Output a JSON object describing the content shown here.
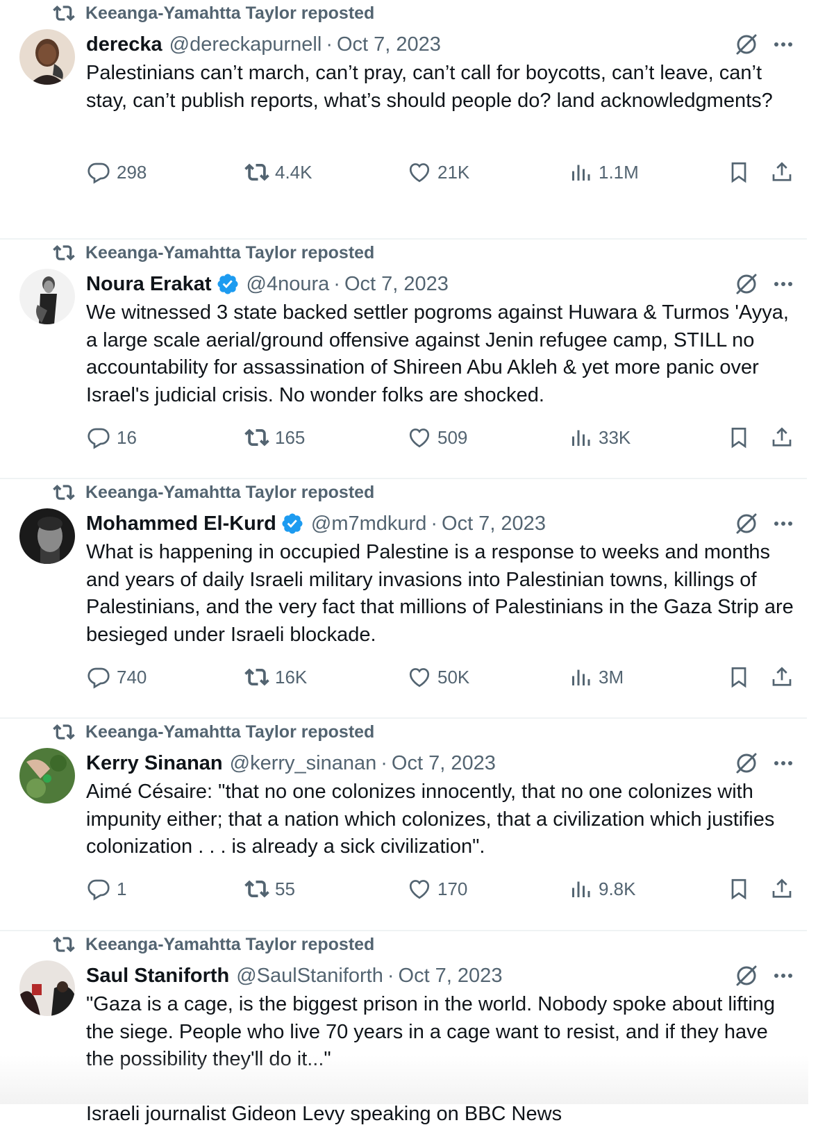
{
  "reposter_label": "Keeanga-Yamahtta Taylor reposted",
  "colors": {
    "text_primary": "#0f1419",
    "text_secondary": "#536471",
    "verified_badge": "#1d9bf0",
    "divider": "#eff3f4"
  },
  "icons": {
    "repost": "repost-icon",
    "reply": "reply-icon",
    "like": "heart-icon",
    "views": "views-icon",
    "bookmark": "bookmark-icon",
    "share": "share-icon",
    "grok": "grok-icon",
    "more": "more-icon",
    "verified": "verified-badge-icon"
  },
  "tweets": [
    {
      "reposter": "Keeanga-Yamahtta Taylor reposted",
      "name": "derecka",
      "verified": false,
      "handle": "@dereckapurnell",
      "separator": "·",
      "date": "Oct 7, 2023",
      "text": "Palestinians can’t march, can’t pray, can’t call for boycotts, can’t leave, can’t stay, can’t publish reports, what’s should people do? land acknowledgments?",
      "replies": "298",
      "reposts": "4.4K",
      "likes": "21K",
      "views": "1.1M"
    },
    {
      "reposter": "Keeanga-Yamahtta Taylor reposted",
      "name": "Noura Erakat",
      "verified": true,
      "handle": "@4noura",
      "separator": "·",
      "date": "Oct 7, 2023",
      "text": "We witnessed 3 state backed settler pogroms against Huwara & Turmos 'Ayya, a large scale aerial/ground offensive against Jenin refugee camp, STILL no accountability for assassination of Shireen Abu Akleh & yet more panic over Israel's judicial crisis. No wonder folks are shocked.",
      "replies": "16",
      "reposts": "165",
      "likes": "509",
      "views": "33K"
    },
    {
      "reposter": "Keeanga-Yamahtta Taylor reposted",
      "name": "Mohammed El-Kurd",
      "verified": true,
      "handle": "@m7mdkurd",
      "separator": "·",
      "date": "Oct 7, 2023",
      "text": "What is happening in occupied Palestine is a response to weeks and months and years of daily Israeli military invasions into Palestinian towns, killings of Palestinians, and the very fact that millions of Palestinians in the Gaza Strip are besieged under Israeli blockade.",
      "replies": "740",
      "reposts": "16K",
      "likes": "50K",
      "views": "3M"
    },
    {
      "reposter": "Keeanga-Yamahtta Taylor reposted",
      "name": "Kerry Sinanan",
      "verified": false,
      "handle": "@kerry_sinanan",
      "separator": "·",
      "date": "Oct 7, 2023",
      "text": "Aimé Césaire: \"that no one colonizes innocently, that no one colonizes with impunity either; that a nation which colonizes, that a civilization which justifies colonization . . . is already a sick civilization\".",
      "replies": "1",
      "reposts": "55",
      "likes": "170",
      "views": "9.8K"
    },
    {
      "reposter": "Keeanga-Yamahtta Taylor reposted",
      "name": "Saul Staniforth",
      "verified": false,
      "handle": "@SaulStaniforth",
      "separator": "·",
      "date": "Oct 7, 2023",
      "text": "\"Gaza is a cage, is the biggest prison in the world. Nobody spoke about lifting the siege. People who live 70 years in a cage want to resist, and if they have the possibility they'll do it...\"\n\nIsraeli journalist Gideon Levy speaking on BBC News",
      "replies": "",
      "reposts": "",
      "likes": "",
      "views": ""
    }
  ]
}
